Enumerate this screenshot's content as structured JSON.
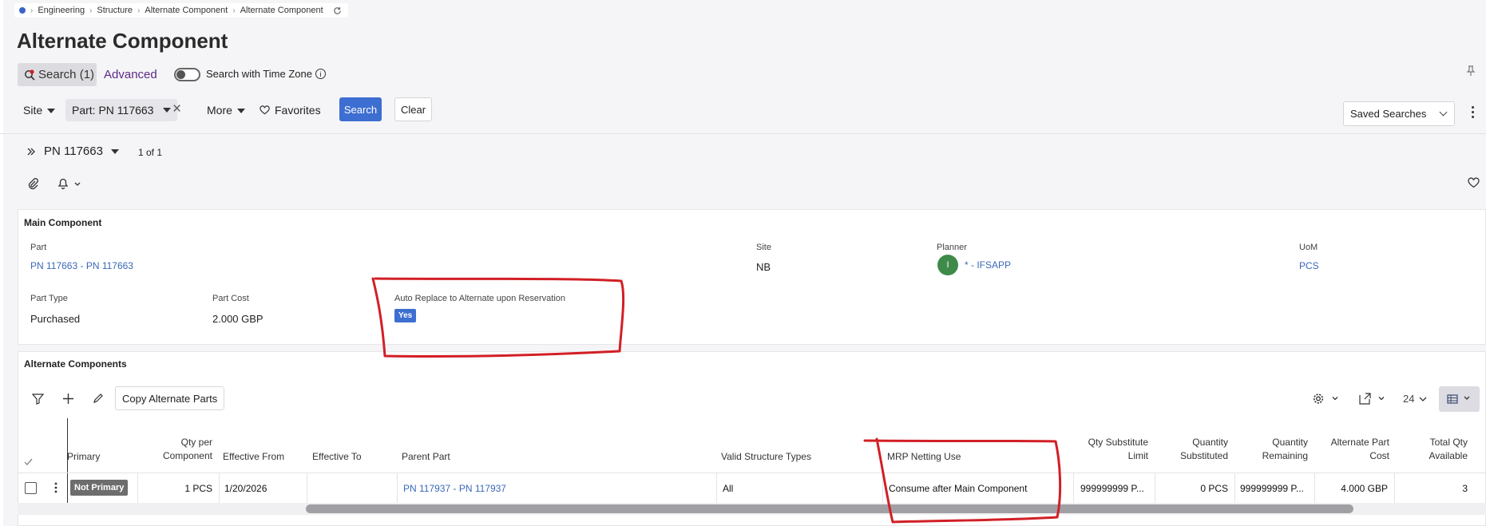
{
  "breadcrumb": {
    "items": [
      "Engineering",
      "Structure",
      "Alternate Component",
      "Alternate Component"
    ]
  },
  "page": {
    "title": "Alternate Component"
  },
  "search_bar": {
    "search_tab": "Search (1)",
    "advanced": "Advanced",
    "time_zone_label": "Search with Time Zone",
    "time_zone_on": false
  },
  "filters": {
    "site": "Site",
    "part": "Part: PN 117663",
    "more": "More",
    "favorites": "Favorites",
    "search_button": "Search",
    "clear_button": "Clear",
    "saved_searches": "Saved Searches"
  },
  "record": {
    "selector": "PN 117663",
    "count": "1 of 1"
  },
  "main_component": {
    "section_title": "Main Component",
    "part_label": "Part",
    "part_value": "PN 117663 - PN 117663",
    "site_label": "Site",
    "site_value": "NB",
    "planner_label": "Planner",
    "planner_initial": "I",
    "planner_value": "* - IFSAPP",
    "uom_label": "UoM",
    "uom_value": "PCS",
    "part_type_label": "Part Type",
    "part_type_value": "Purchased",
    "part_cost_label": "Part Cost",
    "part_cost_value": "2.000 GBP",
    "auto_replace_label": "Auto Replace to Alternate upon Reservation",
    "auto_replace_value": "Yes"
  },
  "alternate_components": {
    "section_title": "Alternate Components",
    "copy_button": "Copy Alternate Parts",
    "page_size": "24",
    "columns": {
      "primary": "Primary",
      "qty_per_1": "Qty per",
      "qty_per_2": "Component",
      "effective_from": "Effective From",
      "effective_to": "Effective To",
      "parent_part": "Parent Part",
      "valid_structure": "Valid Structure Types",
      "mrp_netting": "MRP Netting Use",
      "qty_sub_limit_1": "Qty Substitute",
      "qty_sub_limit_2": "Limit",
      "qty_substituted_1": "Quantity",
      "qty_substituted_2": "Substituted",
      "qty_remaining_1": "Quantity",
      "qty_remaining_2": "Remaining",
      "alt_cost_1": "Alternate Part",
      "alt_cost_2": "Cost",
      "total_qty_1": "Total Qty",
      "total_qty_2": "Available"
    },
    "rows": [
      {
        "primary": "Not Primary",
        "qty_per": "1 PCS",
        "effective_from": "1/20/2026",
        "effective_to": "",
        "parent_part": "PN 117937 - PN 117937",
        "valid_structure": "All",
        "mrp_netting": "Consume after Main Component",
        "qty_sub_limit": "999999999 P...",
        "qty_substituted": "0 PCS",
        "qty_remaining": "999999999 P...",
        "alt_cost": "4.000 GBP",
        "total_qty": "3"
      }
    ]
  },
  "colors": {
    "accent": "#3d6ed1",
    "link": "#3a68b8",
    "annotation": "#d21f25",
    "avatar": "#3e8b49"
  }
}
